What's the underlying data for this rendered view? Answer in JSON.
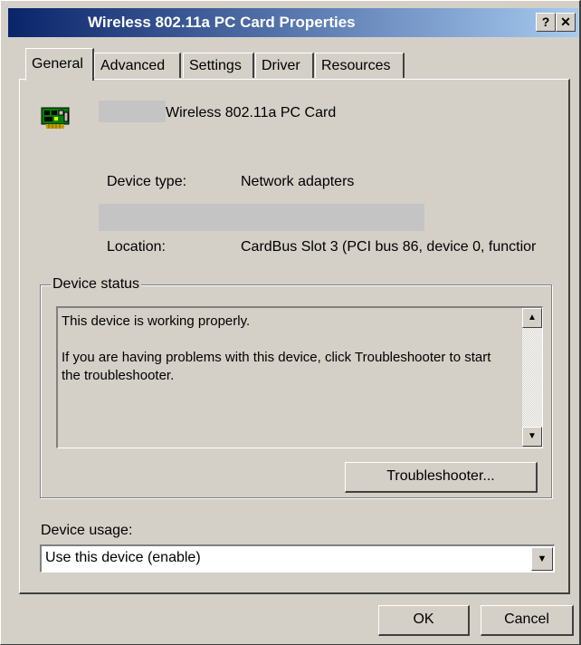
{
  "window": {
    "title": "Wireless 802.11a PC Card Properties",
    "help_button": "?",
    "close_button": "✕"
  },
  "tabs": [
    {
      "label": "General",
      "selected": true
    },
    {
      "label": "Advanced",
      "selected": false
    },
    {
      "label": "Settings",
      "selected": false
    },
    {
      "label": "Driver",
      "selected": false
    },
    {
      "label": "Resources",
      "selected": false
    }
  ],
  "device": {
    "icon": "network-card-icon",
    "name": "Wireless 802.11a PC Card",
    "type_label": "Device type:",
    "type_value": "Network adapters",
    "location_label": "Location:",
    "location_value": "CardBus Slot 3 (PCI bus 86, device 0, functior"
  },
  "device_status": {
    "legend": "Device status",
    "line1": "This device is working properly.",
    "line2": "If you are having problems with this device, click Troubleshooter to start the troubleshooter.",
    "troubleshooter_button": "Troubleshooter..."
  },
  "device_usage": {
    "label": "Device usage:",
    "selected": "Use this device (enable)"
  },
  "buttons": {
    "ok": "OK",
    "cancel": "Cancel"
  },
  "colors": {
    "face": "#d4d0c8",
    "title_start": "#0a246a",
    "title_end": "#a6caf0"
  }
}
